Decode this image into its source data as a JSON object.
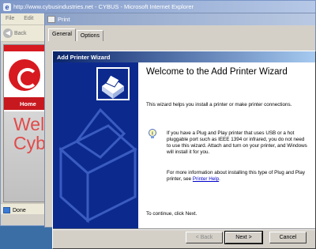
{
  "ie": {
    "title": "http://www.cybusindustries.net - CYBUS - Microsoft Internet Explorer",
    "menu": [
      "File",
      "Edit"
    ],
    "back_label": "Back",
    "status_text": "Done",
    "site": {
      "nav_label": "Home",
      "hero_text": "Wel\nCybu"
    }
  },
  "print_dialog": {
    "title": "Print",
    "tabs": [
      "General",
      "Options"
    ]
  },
  "wizard": {
    "title": "Add Printer Wizard",
    "heading": "Welcome to the Add Printer Wizard",
    "intro": "This wizard helps you install a printer or make printer connections.",
    "pnp": "If you have a Plug and Play printer that uses USB or a hot pluggable port such as IEEE 1394 or infrared, you do not need to use this wizard. Attach and turn on your printer, and Windows will install it for you.",
    "more_prefix": "For more information about installing this type of Plug and Play printer, see ",
    "more_link": "Printer Help",
    "more_suffix": ".",
    "continue": "To continue, click Next.",
    "buttons": {
      "back": "< Back",
      "next": "Next >",
      "cancel": "Cancel"
    }
  },
  "colors": {
    "wizard_title_start": "#0a246a",
    "wizard_side": "#0c2a8e",
    "site_red": "#d71920",
    "desktop": "#3a6ea5"
  }
}
